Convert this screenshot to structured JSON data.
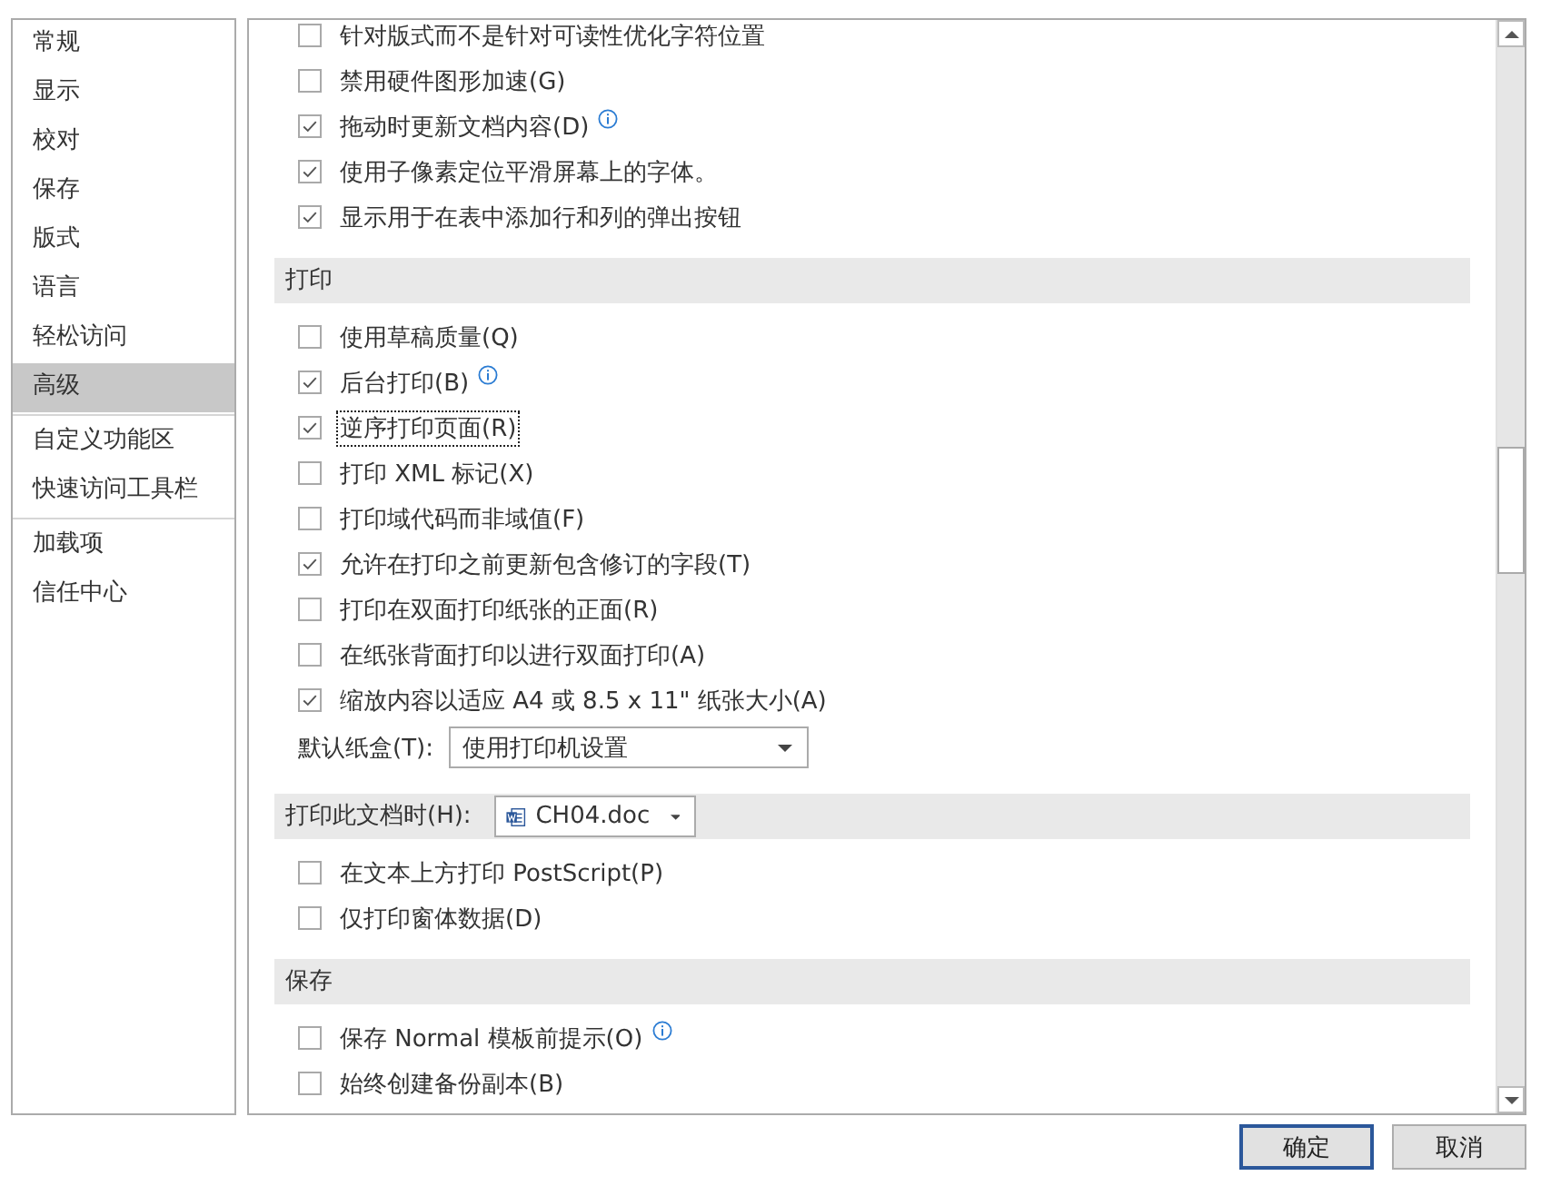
{
  "sidebar": {
    "groups": [
      [
        {
          "label": "常规",
          "selected": false
        },
        {
          "label": "显示",
          "selected": false
        },
        {
          "label": "校对",
          "selected": false
        },
        {
          "label": "保存",
          "selected": false
        },
        {
          "label": "版式",
          "selected": false
        },
        {
          "label": "语言",
          "selected": false
        },
        {
          "label": "轻松访问",
          "selected": false
        },
        {
          "label": "高级",
          "selected": true
        }
      ],
      [
        {
          "label": "自定义功能区",
          "selected": false
        },
        {
          "label": "快速访问工具栏",
          "selected": false
        }
      ],
      [
        {
          "label": "加载项",
          "selected": false
        },
        {
          "label": "信任中心",
          "selected": false
        }
      ]
    ]
  },
  "content": [
    {
      "kind": "checkbox",
      "label": "针对版式而不是针对可读性优化字符位置",
      "checked": false,
      "info": false,
      "focused": false
    },
    {
      "kind": "checkbox",
      "label": "禁用硬件图形加速(G)",
      "checked": false,
      "info": false,
      "focused": false
    },
    {
      "kind": "checkbox",
      "label": "拖动时更新文档内容(D)",
      "checked": true,
      "info": true,
      "focused": false
    },
    {
      "kind": "checkbox",
      "label": "使用子像素定位平滑屏幕上的字体。",
      "checked": true,
      "info": false,
      "focused": false
    },
    {
      "kind": "checkbox",
      "label": "显示用于在表中添加行和列的弹出按钮",
      "checked": true,
      "info": false,
      "focused": false
    },
    {
      "kind": "header",
      "title": "打印"
    },
    {
      "kind": "checkbox",
      "label": "使用草稿质量(Q)",
      "checked": false,
      "info": false,
      "focused": false
    },
    {
      "kind": "checkbox",
      "label": "后台打印(B)",
      "checked": true,
      "info": true,
      "focused": false
    },
    {
      "kind": "checkbox",
      "label": "逆序打印页面(R)",
      "checked": true,
      "info": false,
      "focused": true
    },
    {
      "kind": "checkbox",
      "label": "打印 XML 标记(X)",
      "checked": false,
      "info": false,
      "focused": false
    },
    {
      "kind": "checkbox",
      "label": "打印域代码而非域值(F)",
      "checked": false,
      "info": false,
      "focused": false
    },
    {
      "kind": "checkbox",
      "label": "允许在打印之前更新包含修订的字段(T)",
      "checked": true,
      "info": false,
      "focused": false
    },
    {
      "kind": "checkbox",
      "label": "打印在双面打印纸张的正面(R)",
      "checked": false,
      "info": false,
      "focused": false
    },
    {
      "kind": "checkbox",
      "label": "在纸张背面打印以进行双面打印(A)",
      "checked": false,
      "info": false,
      "focused": false
    },
    {
      "kind": "checkbox",
      "label": "缩放内容以适应 A4 或 8.5 x 11\" 纸张大小(A)",
      "checked": true,
      "info": false,
      "focused": false
    },
    {
      "kind": "dropdown",
      "label": "默认纸盒(T):",
      "value": "使用打印机设置"
    },
    {
      "kind": "header_dropdown",
      "title": "打印此文档时(H):",
      "value": "CH04.doc"
    },
    {
      "kind": "checkbox",
      "label": "在文本上方打印 PostScript(P)",
      "checked": false,
      "info": false,
      "focused": false
    },
    {
      "kind": "checkbox",
      "label": "仅打印窗体数据(D)",
      "checked": false,
      "info": false,
      "focused": false
    },
    {
      "kind": "header",
      "title": "保存"
    },
    {
      "kind": "checkbox",
      "label": "保存 Normal 模板前提示(O)",
      "checked": false,
      "info": true,
      "focused": false
    },
    {
      "kind": "checkbox",
      "label": "始终创建备份副本(B)",
      "checked": false,
      "info": false,
      "focused": false
    }
  ],
  "buttons": [
    {
      "label": "确定",
      "default": true
    },
    {
      "label": "取消",
      "default": false
    }
  ]
}
